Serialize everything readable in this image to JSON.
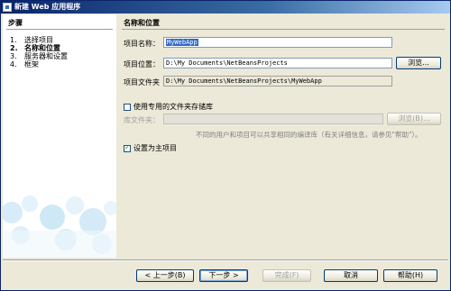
{
  "window": {
    "title": "新建 Web 应用程序"
  },
  "steps": {
    "header": "步骤",
    "items": [
      {
        "num": "1.",
        "label": "选择项目",
        "active": false
      },
      {
        "num": "2.",
        "label": "名称和位置",
        "active": true
      },
      {
        "num": "3.",
        "label": "服务器和设置",
        "active": false
      },
      {
        "num": "4.",
        "label": "框架",
        "active": false
      }
    ]
  },
  "panel": {
    "title": "名称和位置",
    "project_name_label": "项目名称：",
    "project_name_value": "MyWebApp",
    "project_location_label": "项目位置：",
    "project_location_value": "D:\\My Documents\\NetBeansProjects",
    "browse_label": "浏览...",
    "project_folder_label": "项目文件夹",
    "project_folder_value": "D:\\My Documents\\NetBeansProjects\\MyWebApp",
    "use_library_checkbox_label": "使用专用的文件夹存储库",
    "use_library_checked": false,
    "library_folder_label": "库文件夹：",
    "library_folder_value": "",
    "library_browse_label": "浏览(B)...",
    "library_help_text": "不同的用户和项目可以共享相同的编译库（有关详细信息，请参见\"帮助\"）。",
    "main_project_checkbox_label": "设置为主项目",
    "main_project_checked": true
  },
  "buttons": {
    "back": "< 上一步(B)",
    "next": "下一步 >",
    "finish": "完成(F)",
    "cancel": "取消",
    "help": "帮助(H)"
  }
}
